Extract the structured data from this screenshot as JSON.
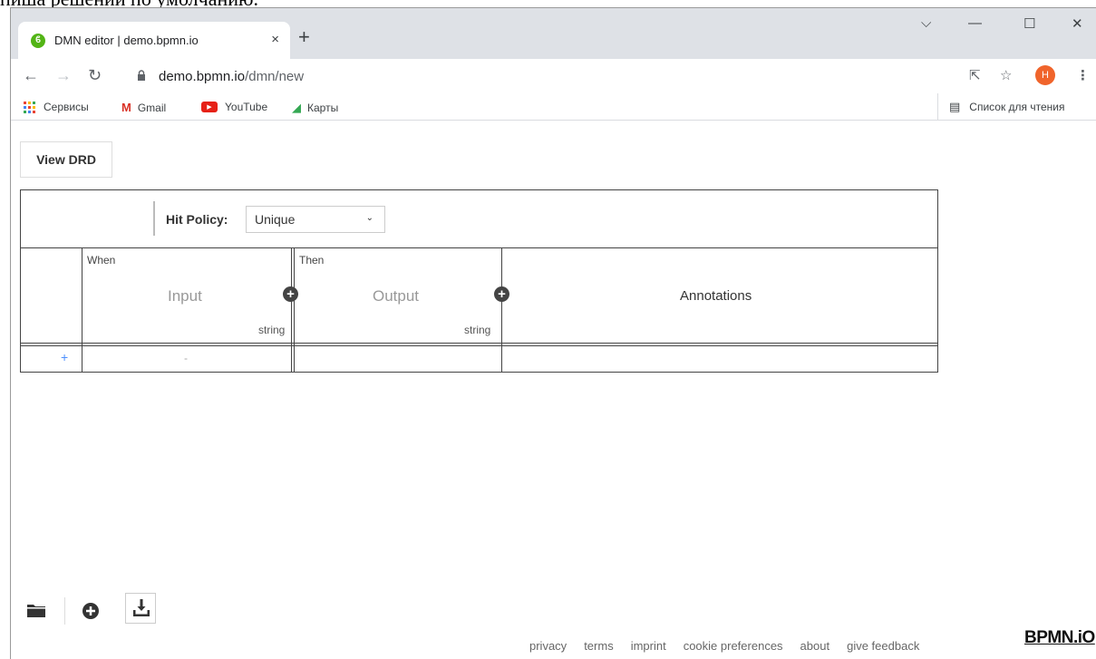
{
  "top_snippet": "пиша решении по умолчанию.",
  "browser": {
    "tab_title": "DMN editor | demo.bpmn.io",
    "tab_close_icon": "×",
    "new_tab_icon": "+",
    "window_controls": {
      "dropdown": "⌵",
      "minimize": "—",
      "maximize": "☐",
      "close": "✕"
    },
    "url_host": "demo.bpmn.io",
    "url_path": "/dmn/new",
    "profile_letter": "H",
    "bookmarks": [
      {
        "label": "Сервисы"
      },
      {
        "label": "Gmail"
      },
      {
        "label": "YouTube"
      },
      {
        "label": "Карты"
      }
    ],
    "reading_list": "Список для чтения"
  },
  "editor": {
    "view_drd_label": "View DRD",
    "hit_policy_label": "Hit Policy:",
    "hit_policy_value": "Unique",
    "when_label": "When",
    "then_label": "Then",
    "input_header": "Input",
    "output_header": "Output",
    "annotations_header": "Annotations",
    "input_type": "string",
    "output_type": "string",
    "add_rule": "+",
    "empty_input_cell": "-"
  },
  "footer": {
    "links": [
      "privacy",
      "terms",
      "imprint",
      "cookie preferences",
      "about",
      "give feedback"
    ],
    "brand": "BPMN.iO"
  },
  "colors": {
    "tab_strip": "#dee1e6",
    "favicon_green": "#52b415",
    "profile_orange": "#f0642b",
    "add_rule_blue": "#4d90fe"
  }
}
